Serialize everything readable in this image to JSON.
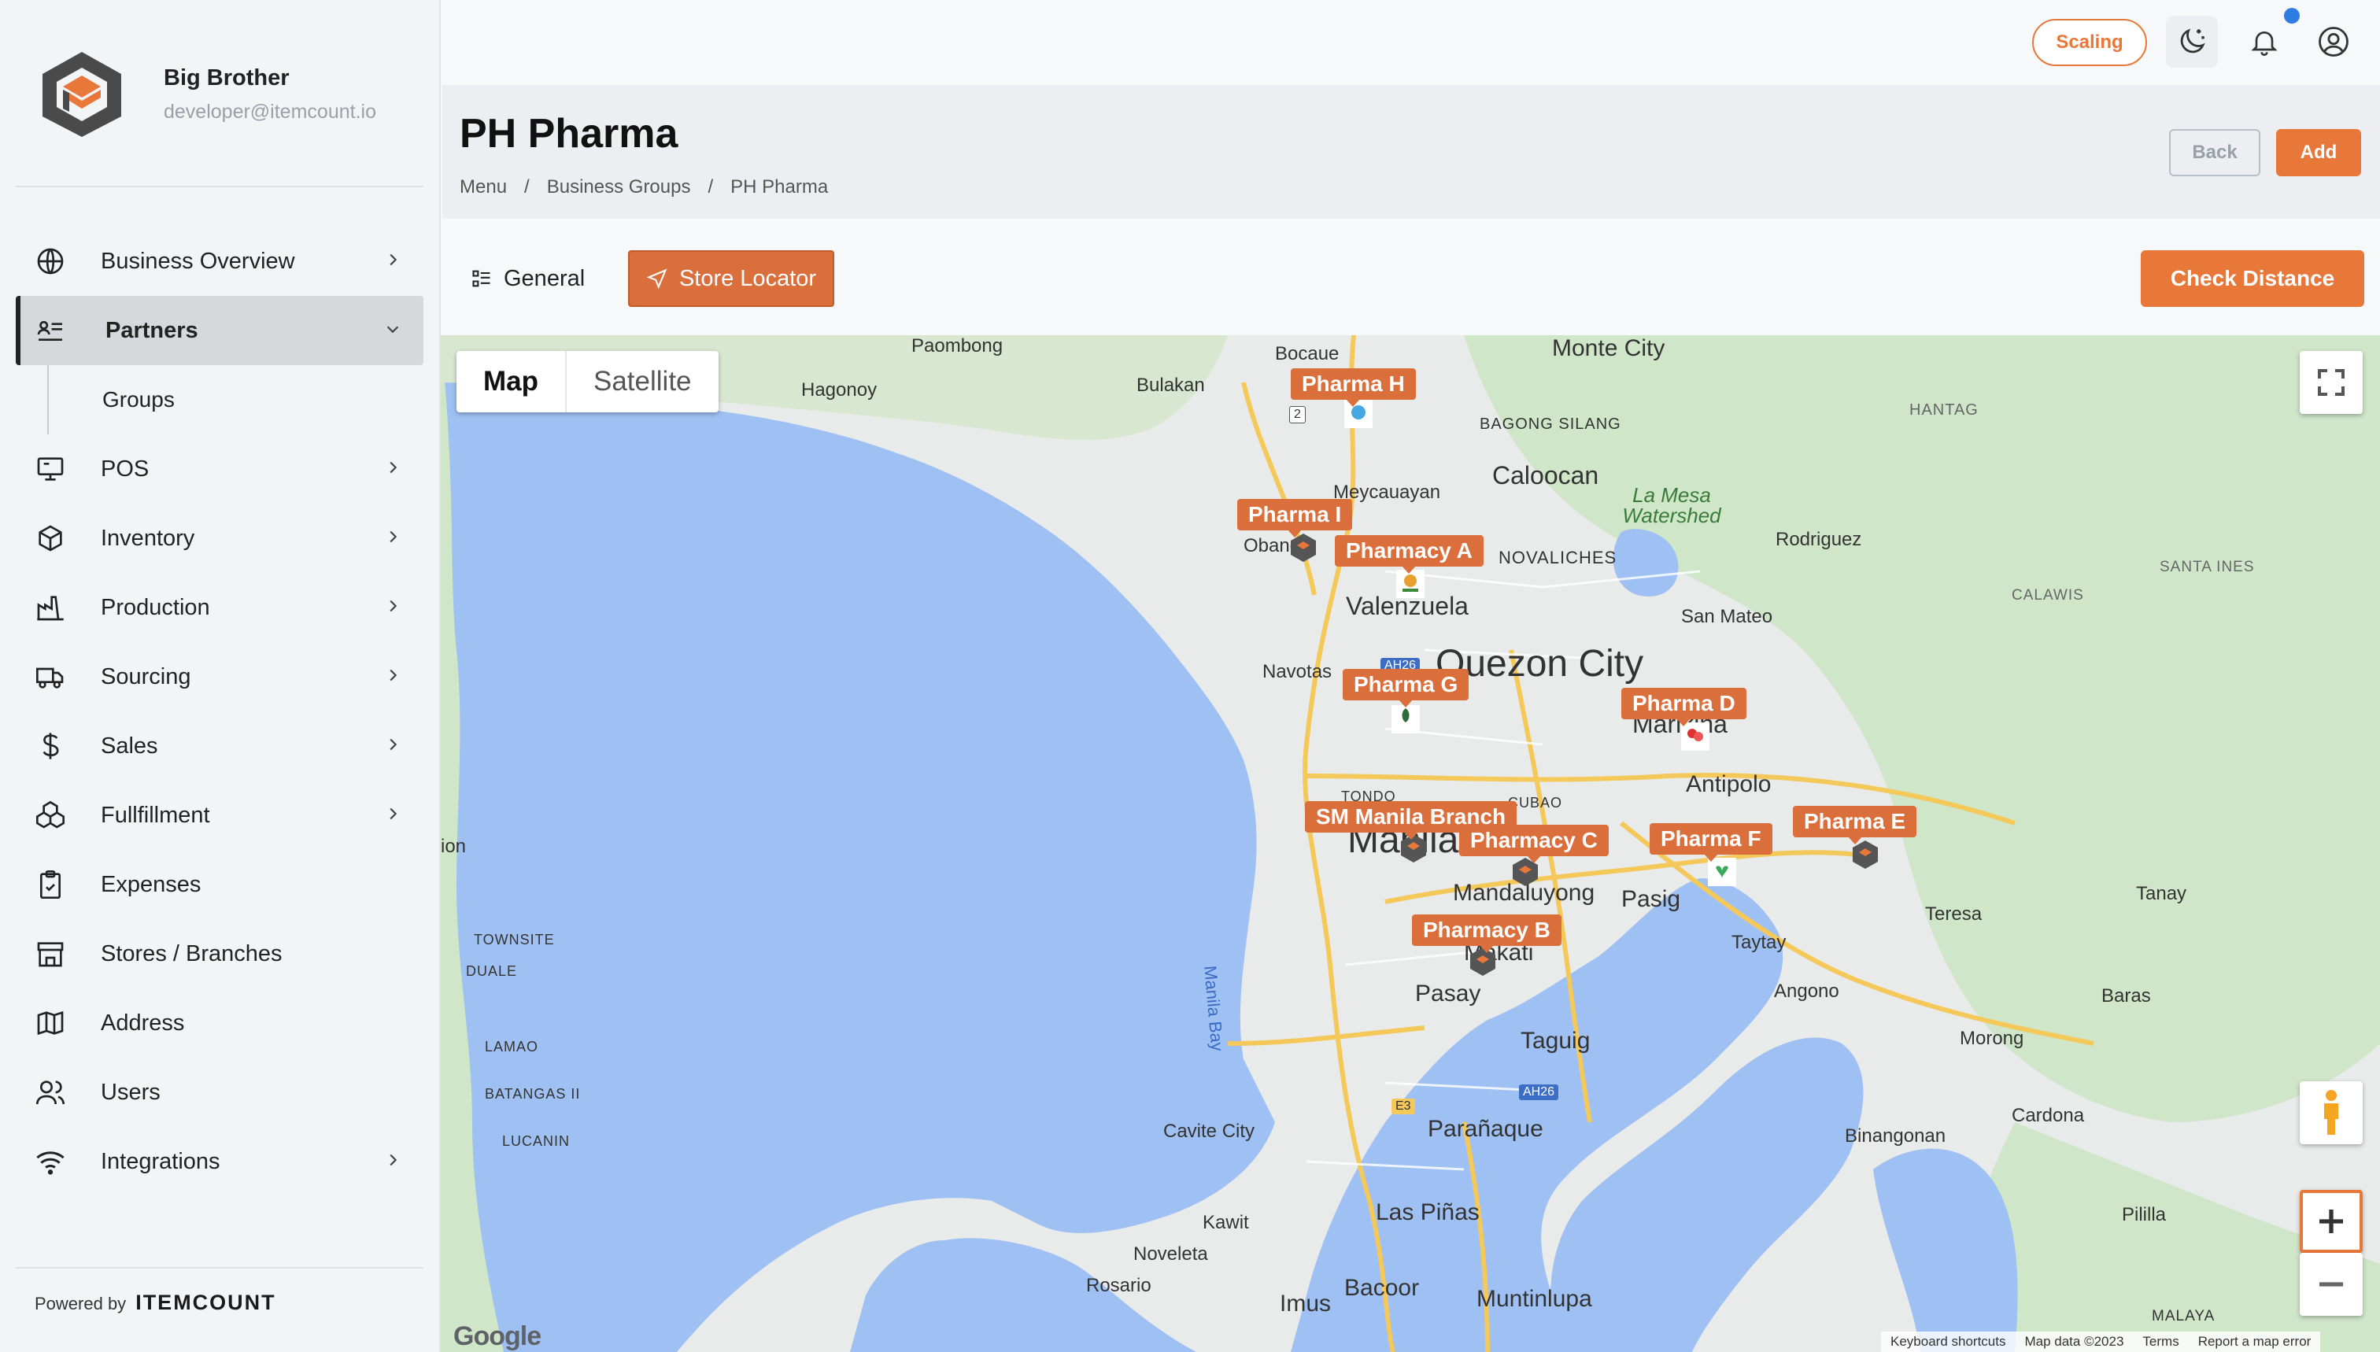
{
  "brand": {
    "name": "Big Brother",
    "email": "developer@itemcount.io"
  },
  "sidebar": {
    "items": [
      {
        "label": "Business Overview",
        "icon": "globe-icon"
      },
      {
        "label": "Partners",
        "icon": "partners-icon"
      },
      {
        "label": "POS",
        "icon": "pos-icon"
      },
      {
        "label": "Inventory",
        "icon": "box-icon"
      },
      {
        "label": "Production",
        "icon": "factory-icon"
      },
      {
        "label": "Sourcing",
        "icon": "truck-icon"
      },
      {
        "label": "Sales",
        "icon": "dollar-icon"
      },
      {
        "label": "Fullfillment",
        "icon": "boxes-icon"
      },
      {
        "label": "Expenses",
        "icon": "clipboard-icon"
      },
      {
        "label": "Stores / Branches",
        "icon": "store-icon"
      },
      {
        "label": "Address",
        "icon": "map-icon"
      },
      {
        "label": "Users",
        "icon": "users-icon"
      },
      {
        "label": "Integrations",
        "icon": "wifi-icon"
      }
    ],
    "sub_items": [
      {
        "label": "Groups"
      }
    ],
    "powered_by": "Powered by",
    "powered_brand": "ITEMCOUNT"
  },
  "topbar": {
    "scaling_label": "Scaling"
  },
  "header": {
    "title": "PH Pharma",
    "breadcrumb": [
      "Menu",
      "/",
      "Business Groups",
      "/",
      "PH Pharma"
    ],
    "back_label": "Back",
    "add_label": "Add"
  },
  "tabs": {
    "general": "General",
    "store_locator": "Store Locator",
    "check_distance": "Check Distance"
  },
  "map": {
    "type_map": "Map",
    "type_satellite": "Satellite",
    "pins": [
      "Pharma H",
      "Pharma I",
      "Pharmacy A",
      "Pharma G",
      "Pharma D",
      "SM Manila Branch",
      "Pharmacy C",
      "Pharma F",
      "Pharma E",
      "Pharmacy B"
    ],
    "places": [
      "Paombong",
      "Bocaue",
      "Monte City",
      "Hagonoy",
      "Bulakan",
      "BAGONG SILANG",
      "HANTAG",
      "Meycauayan",
      "Caloocan",
      "La Mesa Watershed",
      "Rodriguez",
      "Obando",
      "NOVALICHES",
      "SANTA INES",
      "CALAWIS",
      "Valenzuela",
      "San Mateo",
      "Navotas",
      "Quezon City",
      "Marikina",
      "Antipolo",
      "TONDO",
      "CUBAO",
      "Manila",
      "Mandaluyong",
      "Pasig",
      "Teresa",
      "Tanay",
      "TOWNSITE",
      "DUALE",
      "Manila Bay",
      "Makati",
      "Taytay",
      "Pasay",
      "Angono",
      "Baras",
      "LAMAO",
      "Taguig",
      "Morong",
      "BATANGAS II",
      "LUCANIN",
      "Cavite City",
      "Parañaque",
      "Binangonan",
      "Cardona",
      "Kawit",
      "Las Piñas",
      "Pililla",
      "Noveleta",
      "Rosario",
      "Bacoor",
      "Imus",
      "Muntinlupa",
      "MALAYA",
      "ion",
      "AH26",
      "E3",
      "2"
    ],
    "attribution": [
      "Keyboard shortcuts",
      "Map data ©2023",
      "Terms",
      "Report a map error"
    ],
    "google": "Google"
  },
  "colors": {
    "accent": "#e8773a",
    "pin": "#db6f3c",
    "water": "#9fc0f2",
    "land": "#e9eaea",
    "green": "#cfe6c9"
  }
}
